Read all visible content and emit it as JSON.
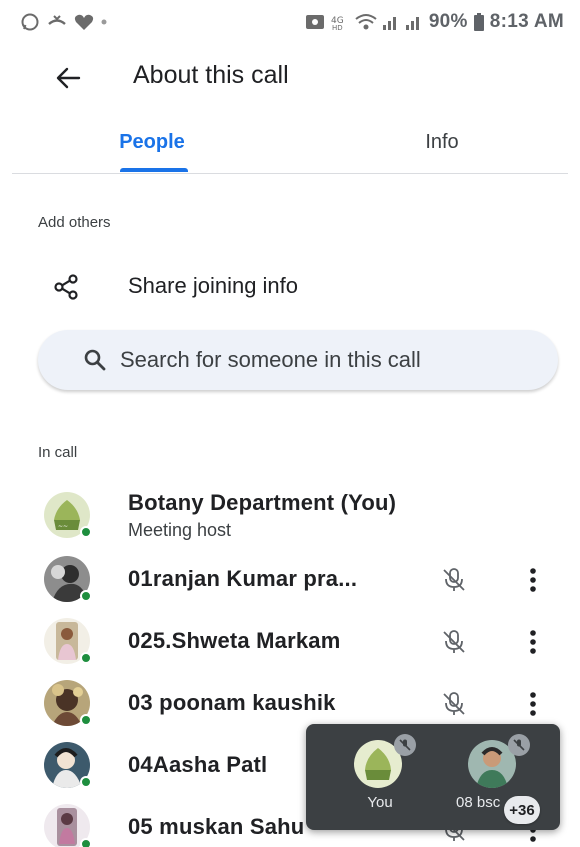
{
  "status_bar": {
    "battery": "90%",
    "time": "8:13 AM",
    "left_icons": [
      "whatsapp-icon",
      "missed-call-icon",
      "heart-icon",
      "dot-icon"
    ],
    "right_icons": [
      "cast-icon",
      "hd-icon",
      "wifi-icon",
      "signal-icon",
      "signal-icon",
      "battery-icon"
    ]
  },
  "header": {
    "back_icon": "arrow-back-icon",
    "title": "About this call"
  },
  "tabs": [
    {
      "label": "People",
      "selected": true
    },
    {
      "label": "Info",
      "selected": false
    }
  ],
  "add_others": {
    "label": "Add others",
    "share_label": "Share joining info",
    "share_icon": "share-icon"
  },
  "search": {
    "placeholder": "Search for someone in this call",
    "icon": "search-icon"
  },
  "in_call": {
    "label": "In call",
    "participants": [
      {
        "name": "Botany Department (You)",
        "role": "Meeting host",
        "muted": false,
        "online": true
      },
      {
        "name": "01ranjan Kumar pra...",
        "muted": true,
        "online": true
      },
      {
        "name": "025.Shweta Markam",
        "muted": true,
        "online": true
      },
      {
        "name": "03 poonam kaushik",
        "muted": true,
        "online": true
      },
      {
        "name": "04Aasha Patl",
        "muted": true,
        "online": true
      },
      {
        "name": "05 muskan Sahu",
        "muted": true,
        "online": true
      }
    ]
  },
  "mini_panel": {
    "tiles": [
      {
        "label": "You",
        "muted": true
      },
      {
        "label": "08 bsc",
        "muted": true
      }
    ],
    "more_count": "+36"
  },
  "colors": {
    "accent": "#1a73e8",
    "presence": "#1e8e3e",
    "panel_bg": "#3c4043",
    "search_bg": "#eef2f9"
  }
}
